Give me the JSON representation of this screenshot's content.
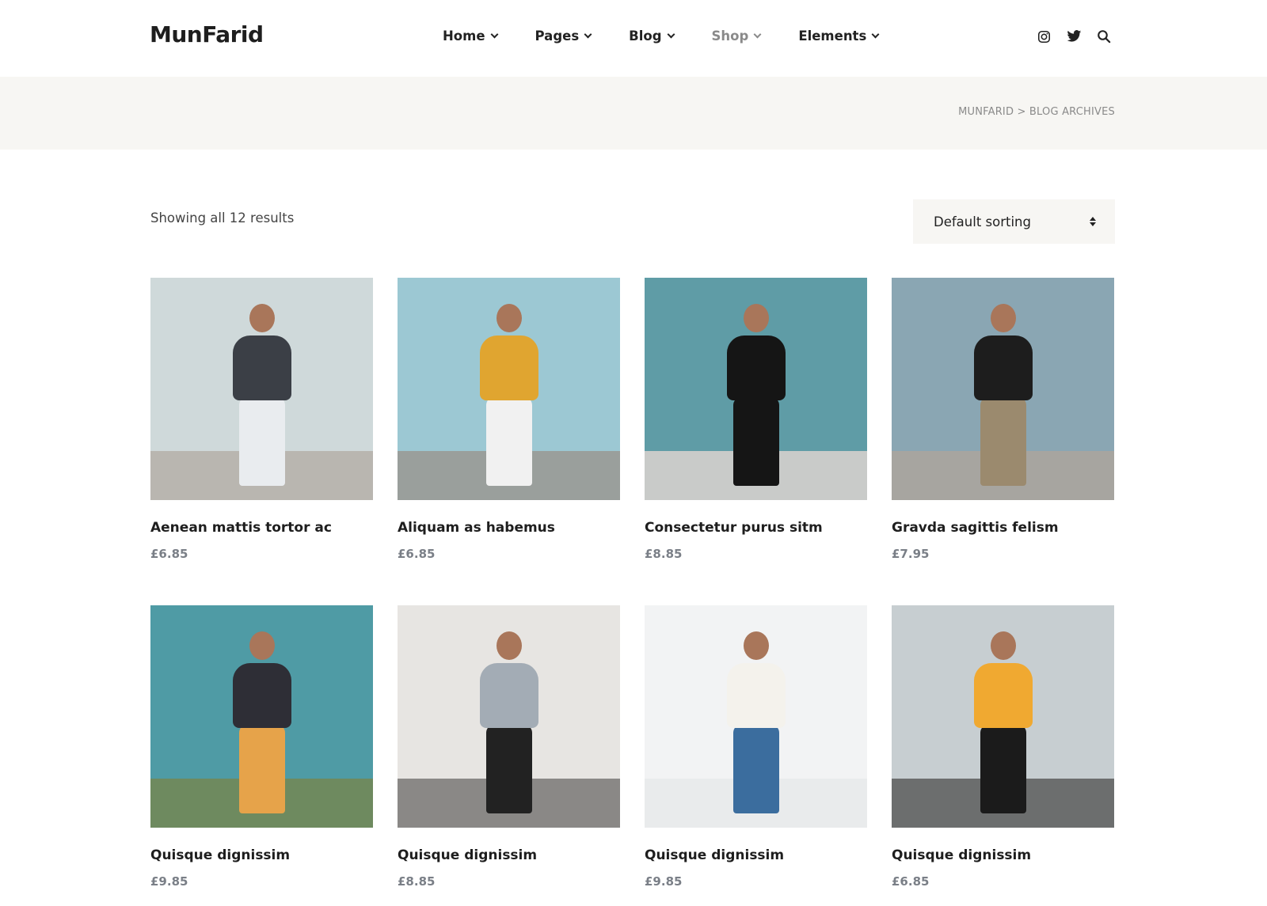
{
  "header": {
    "logo": "MunFarid",
    "nav": [
      {
        "label": "Home",
        "active": false
      },
      {
        "label": "Pages",
        "active": false
      },
      {
        "label": "Blog",
        "active": false
      },
      {
        "label": "Shop",
        "active": true
      },
      {
        "label": "Elements",
        "active": false
      }
    ],
    "icons": [
      "instagram-icon",
      "twitter-icon",
      "search-icon"
    ]
  },
  "breadcrumb": "MUNFARID > BLOG ARCHIVES",
  "toolbar": {
    "result_count": "Showing all 12 results",
    "sort_selected": "Default sorting"
  },
  "products": [
    {
      "title": "Aenean mattis tortor ac",
      "price": "£6.85",
      "sky": "#cfd9da",
      "ground": "#b9b6b0",
      "outfit": "#e9ecef",
      "top": "#3b3f46"
    },
    {
      "title": "Aliquam as habemus",
      "price": "£6.85",
      "sky": "#9cc8d3",
      "ground": "#9a9f9c",
      "outfit": "#f1f1f1",
      "top": "#e0a530"
    },
    {
      "title": "Consectetur purus sitm",
      "price": "£8.85",
      "sky": "#5f9ca6",
      "ground": "#c9cbc9",
      "outfit": "#151515",
      "top": "#151515"
    },
    {
      "title": "Gravda sagittis felism",
      "price": "£7.95",
      "sky": "#8aa6b3",
      "ground": "#a7a5a0",
      "outfit": "#9b8a6e",
      "top": "#1d1d1d"
    },
    {
      "title": "Quisque dignissim",
      "price": "£9.85",
      "sky": "#4f9ba5",
      "ground": "#6e8a5f",
      "outfit": "#e6a34a",
      "top": "#2e2e36"
    },
    {
      "title": "Quisque dignissim",
      "price": "£8.85",
      "sky": "#e7e5e2",
      "ground": "#8a8886",
      "outfit": "#222222",
      "top": "#a3acb5"
    },
    {
      "title": "Quisque dignissim",
      "price": "£9.85",
      "sky": "#f2f3f4",
      "ground": "#e9ebec",
      "outfit": "#3b6d9e",
      "top": "#f4f2ec"
    },
    {
      "title": "Quisque dignissim",
      "price": "£6.85",
      "sky": "#c7ced1",
      "ground": "#6c6e6e",
      "outfit": "#1b1b1b",
      "top": "#f0a931"
    }
  ]
}
